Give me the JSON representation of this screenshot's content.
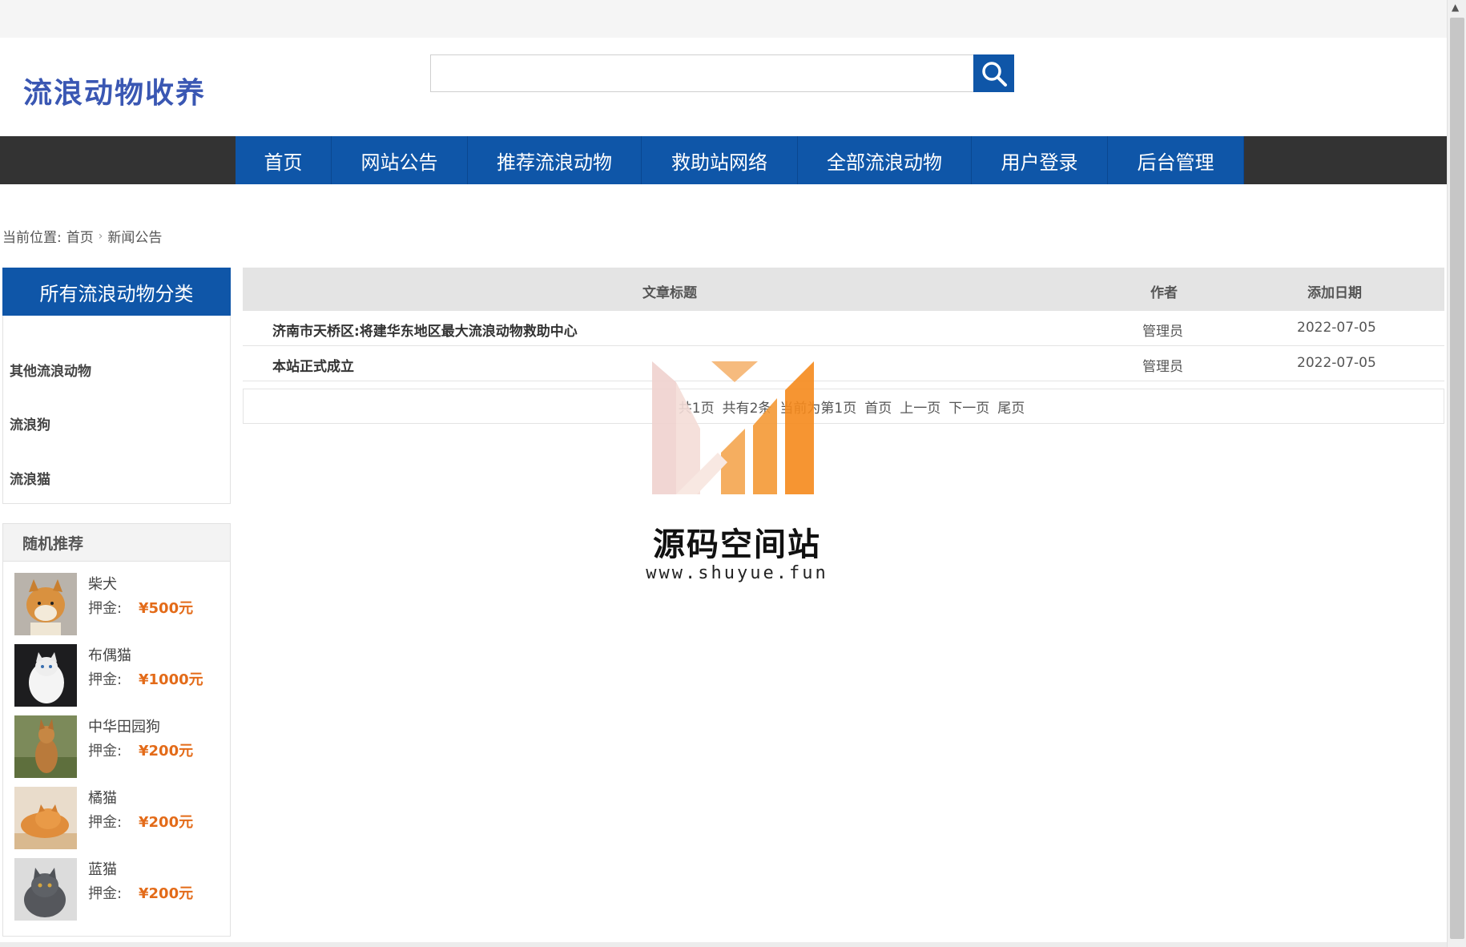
{
  "header": {
    "logo": "流浪动物收养",
    "search": {
      "value": "",
      "placeholder": ""
    }
  },
  "nav": {
    "items": [
      {
        "label": "首页"
      },
      {
        "label": "网站公告"
      },
      {
        "label": "推荐流浪动物"
      },
      {
        "label": "救助站网络"
      },
      {
        "label": "全部流浪动物"
      },
      {
        "label": "用户登录"
      },
      {
        "label": "后台管理"
      }
    ]
  },
  "breadcrumb": {
    "prefix": "当前位置:",
    "home": "首页",
    "current": "新闻公告"
  },
  "sidebar": {
    "category_title": "所有流浪动物分类",
    "categories": [
      {
        "label": "其他流浪动物"
      },
      {
        "label": "流浪狗"
      },
      {
        "label": "流浪猫"
      }
    ],
    "recommend_title": "随机推荐",
    "price_label": "押金:",
    "recommend": [
      {
        "name": "柴犬",
        "price": "¥500元"
      },
      {
        "name": "布偶猫",
        "price": "¥1000元"
      },
      {
        "name": "中华田园狗",
        "price": "¥200元"
      },
      {
        "name": "橘猫",
        "price": "¥200元"
      },
      {
        "name": "蓝猫",
        "price": "¥200元"
      }
    ]
  },
  "table": {
    "columns": [
      "文章标题",
      "作者",
      "添加日期"
    ],
    "rows": [
      {
        "title": "济南市天桥区:将建华东地区最大流浪动物救助中心",
        "author": "管理员",
        "date": "2022-07-05"
      },
      {
        "title": "本站正式成立",
        "author": "管理员",
        "date": "2022-07-05"
      }
    ]
  },
  "pager": {
    "total_pages": "共1页",
    "total_items": "共有2条",
    "current": "当前为第1页",
    "first": "首页",
    "prev": "上一页",
    "next": "下一页",
    "last": "尾页"
  },
  "watermark": {
    "name": "源码空间站",
    "url": "www.shuyue.fun"
  },
  "colors": {
    "primary": "#0f56a8",
    "nav_bg": "#333333",
    "price": "#e36b19",
    "logo": "#3a57b3"
  }
}
